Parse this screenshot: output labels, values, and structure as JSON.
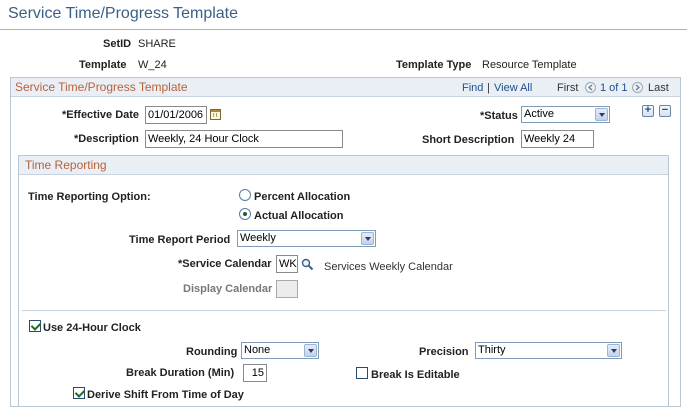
{
  "page": {
    "title": "Service Time/Progress Template"
  },
  "header": {
    "setid": {
      "label": "SetID",
      "value": "SHARE"
    },
    "template": {
      "label": "Template",
      "value": "W_24"
    },
    "template_type": {
      "label": "Template Type",
      "value": "Resource Template"
    }
  },
  "main_group": {
    "title": "Service Time/Progress Template",
    "nav": {
      "find": "Find",
      "separator": "|",
      "view_all": "View All",
      "first": "First",
      "counter": "1 of 1",
      "last": "Last"
    },
    "add_button": "+",
    "delete_button": "−",
    "effective_date": {
      "label": "*Effective Date",
      "value": "01/01/2006"
    },
    "status": {
      "label": "*Status",
      "value": "Active"
    },
    "description": {
      "label": "*Description",
      "value": "Weekly, 24 Hour Clock"
    },
    "short_description": {
      "label": "Short Description",
      "value": "Weekly 24"
    }
  },
  "time_reporting": {
    "title": "Time Reporting",
    "option_label": "Time Reporting Option:",
    "options": [
      {
        "label": "Percent Allocation",
        "selected": false
      },
      {
        "label": "Actual Allocation",
        "selected": true
      }
    ],
    "period": {
      "label": "Time Report Period",
      "value": "Weekly"
    },
    "service_calendar": {
      "label": "*Service Calendar",
      "value": "WK",
      "description": "Services Weekly Calendar"
    },
    "display_calendar": {
      "label": "Display Calendar",
      "value": ""
    },
    "use_24_hour": {
      "label": "Use 24-Hour Clock",
      "checked": true
    },
    "rounding": {
      "label": "Rounding",
      "value": "None"
    },
    "precision": {
      "label": "Precision",
      "value": "Thirty"
    },
    "break_duration": {
      "label": "Break Duration (Min)",
      "value": "15"
    },
    "break_editable": {
      "label": "Break Is Editable",
      "checked": false
    },
    "derive_shift": {
      "label": "Derive Shift From Time of Day",
      "checked": true
    }
  },
  "colors": {
    "title_blue": "#3a5f87",
    "group_title": "#b8623a",
    "link": "#1f4f8c",
    "header_bg": "#e9eff5"
  },
  "icons": [
    "calendar-icon",
    "lookup-icon",
    "first-arrow-icon",
    "last-arrow-icon",
    "add-icon",
    "delete-icon"
  ]
}
